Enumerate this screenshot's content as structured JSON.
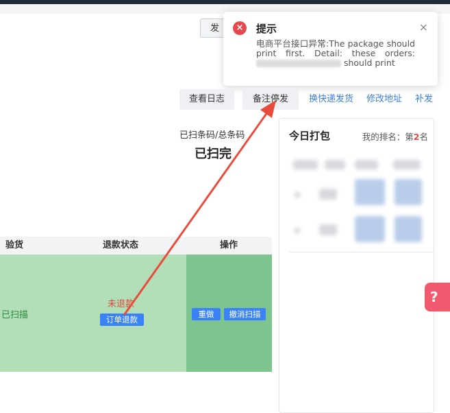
{
  "toolbar": {
    "partial_button_label": "发"
  },
  "toast": {
    "title": "提示",
    "message_before": "电商平台接口异常:The package should print first. Detail: these orders: ",
    "message_after": " should print",
    "close_glyph": "×",
    "error_glyph": "×"
  },
  "actions": {
    "view_log": "查看日志",
    "remark_stop": "备注停发",
    "change_express": "换快递发货",
    "edit_address": "修改地址",
    "reship": "补发"
  },
  "scan": {
    "label": "已扫条码/总条码",
    "status": "已扫完"
  },
  "panel": {
    "title": "今日打包",
    "rank_prefix": "我的排名：第",
    "rank_value": "2",
    "rank_suffix": "名"
  },
  "table": {
    "headers": {
      "inspect": "验货",
      "refund_status": "退款状态",
      "operation": "操作"
    },
    "row": {
      "inspect": "已扫描",
      "refund_status": "未退款",
      "order_refund": "订单退款",
      "redo": "重做",
      "undo_scan": "撤消扫描"
    }
  },
  "help_badge": {
    "icon": "question-chat-icon",
    "glyph": "?"
  },
  "colors": {
    "accent_blue": "#3b82f6",
    "error_red": "#e5484d",
    "annotation_arrow": "#e74c3c"
  }
}
